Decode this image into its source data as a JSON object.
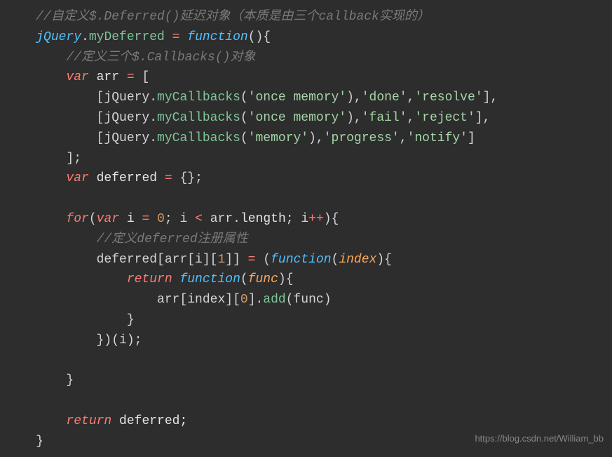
{
  "lines": {
    "l1_comment": "//自定义$.Deferred()延迟对象（本质是由三个callback实现的）",
    "l2_jquery": "jQuery",
    "l2_dot": ".",
    "l2_mydeferred": "myDeferred",
    "l2_eq": " = ",
    "l2_function": "function",
    "l2_parens": "(){",
    "l3_comment": "//定义三个$.Callbacks()对象",
    "l4_var": "var",
    "l4_arr": " arr ",
    "l4_eq": "=",
    "l4_bracket": " [",
    "l5_open": "[jQuery.",
    "l5_mycb": "myCallbacks",
    "l5_p1": "(",
    "l5_str1": "'once memory'",
    "l5_p2": "),",
    "l5_str2": "'done'",
    "l5_c1": ",",
    "l5_str3": "'resolve'",
    "l5_close": "],",
    "l6_open": "[jQuery.",
    "l6_mycb": "myCallbacks",
    "l6_p1": "(",
    "l6_str1": "'once memory'",
    "l6_p2": "),",
    "l6_str2": "'fail'",
    "l6_c1": ",",
    "l6_str3": "'reject'",
    "l6_close": "],",
    "l7_open": "[jQuery.",
    "l7_mycb": "myCallbacks",
    "l7_p1": "(",
    "l7_str1": "'memory'",
    "l7_p2": "),",
    "l7_str2": "'progress'",
    "l7_c1": ",",
    "l7_str3": "'notify'",
    "l7_close": "]",
    "l8_close": "];",
    "l9_var": "var",
    "l9_def": " deferred ",
    "l9_eq": "=",
    "l9_obj": " {};",
    "l11_for": "for",
    "l11_p1": "(",
    "l11_var": "var",
    "l11_i": " i ",
    "l11_eq": "=",
    "l11_sp": " ",
    "l11_zero": "0",
    "l11_sc1": "; i ",
    "l11_lt": "<",
    "l11_arr": " arr.",
    "l11_len": "length",
    "l11_sc2": "; i",
    "l11_inc": "++",
    "l11_p2": "){",
    "l12_comment": "//定义deferred注册属性",
    "l13_def": "deferred[arr[i][",
    "l13_one": "1",
    "l13_mid": "]] ",
    "l13_eq": "=",
    "l13_sp": " (",
    "l13_func": "function",
    "l13_p1": "(",
    "l13_idx": "index",
    "l13_p2": "){",
    "l14_ret": "return",
    "l14_sp": " ",
    "l14_func": "function",
    "l14_p1": "(",
    "l14_param": "func",
    "l14_p2": "){",
    "l15_arr": "arr[index][",
    "l15_zero": "0",
    "l15_mid": "].",
    "l15_add": "add",
    "l15_p1": "(func)",
    "l16_close": "}",
    "l17_close": "})(i);",
    "l19_close": "}",
    "l21_ret": "return",
    "l21_def": " deferred;",
    "l22_close": "}"
  },
  "watermark": "https://blog.csdn.net/William_bb"
}
